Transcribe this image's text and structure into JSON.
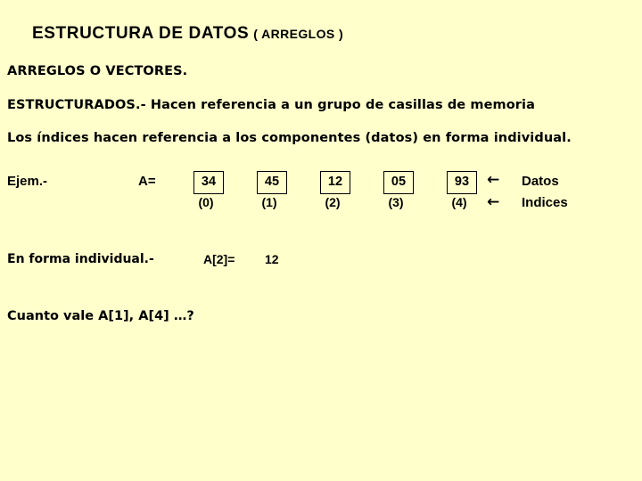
{
  "slide": {
    "background_color": "#ffffcc",
    "text_color": "#000000",
    "title_main": "ESTRUCTURA DE DATOS",
    "title_sub": "( ARREGLOS )",
    "body_lines": [
      "ARREGLOS O VECTORES.",
      "ESTRUCTURADOS.- Hacen referencia a un grupo de casillas de memoria",
      "Los índices hacen referencia a los componentes (datos) en forma individual."
    ],
    "example": {
      "label": "Ejem.-",
      "assignment": "A=",
      "cells": [
        {
          "value": "34",
          "index": "(0)"
        },
        {
          "value": "45",
          "index": "(1)"
        },
        {
          "value": "12",
          "index": "(2)"
        },
        {
          "value": "05",
          "index": "(3)"
        },
        {
          "value": "93",
          "index": "(4)"
        }
      ],
      "legend": {
        "datos_arrow": "←",
        "datos_label": "Datos",
        "indices_arrow": "←",
        "indices_label": "Indices"
      }
    },
    "individual": {
      "label": "En forma individual.-",
      "expression": "A[2]=",
      "value": "12"
    },
    "question": "Cuanto vale A[1], A[4] …?"
  }
}
